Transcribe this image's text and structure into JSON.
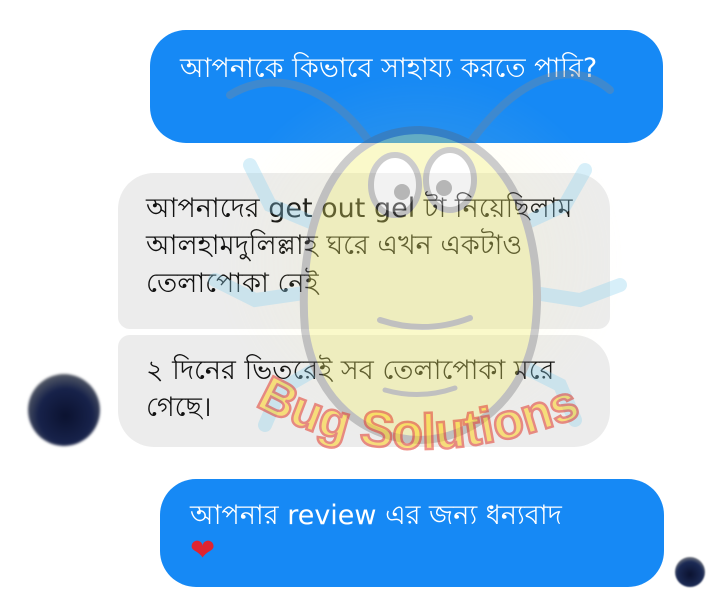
{
  "messages": {
    "m1": "আপনাকে কিভাবে সাহায্য করতে পারি?",
    "m2": "আপনাদের get out gel টা নিয়েছিলাম আলহামদুলিল্লাহ ঘরে এখন একটাও তেলাপোকা নেই",
    "m3": "২ দিনের ভিতরেই সব তেলাপোকা মরে গেছে।",
    "m4": "আপনার review এর জন্য ধন্যবাদ",
    "m4_emoji": "❤"
  },
  "watermark": {
    "text": "Bug Solutions"
  },
  "colors": {
    "sent_bubble": "#1689f5",
    "received_bubble": "#ececec",
    "heart": "#e02430"
  },
  "icons": {
    "watermark_mascot": "cockroach-mascot-icon",
    "heart": "heart-icon"
  }
}
